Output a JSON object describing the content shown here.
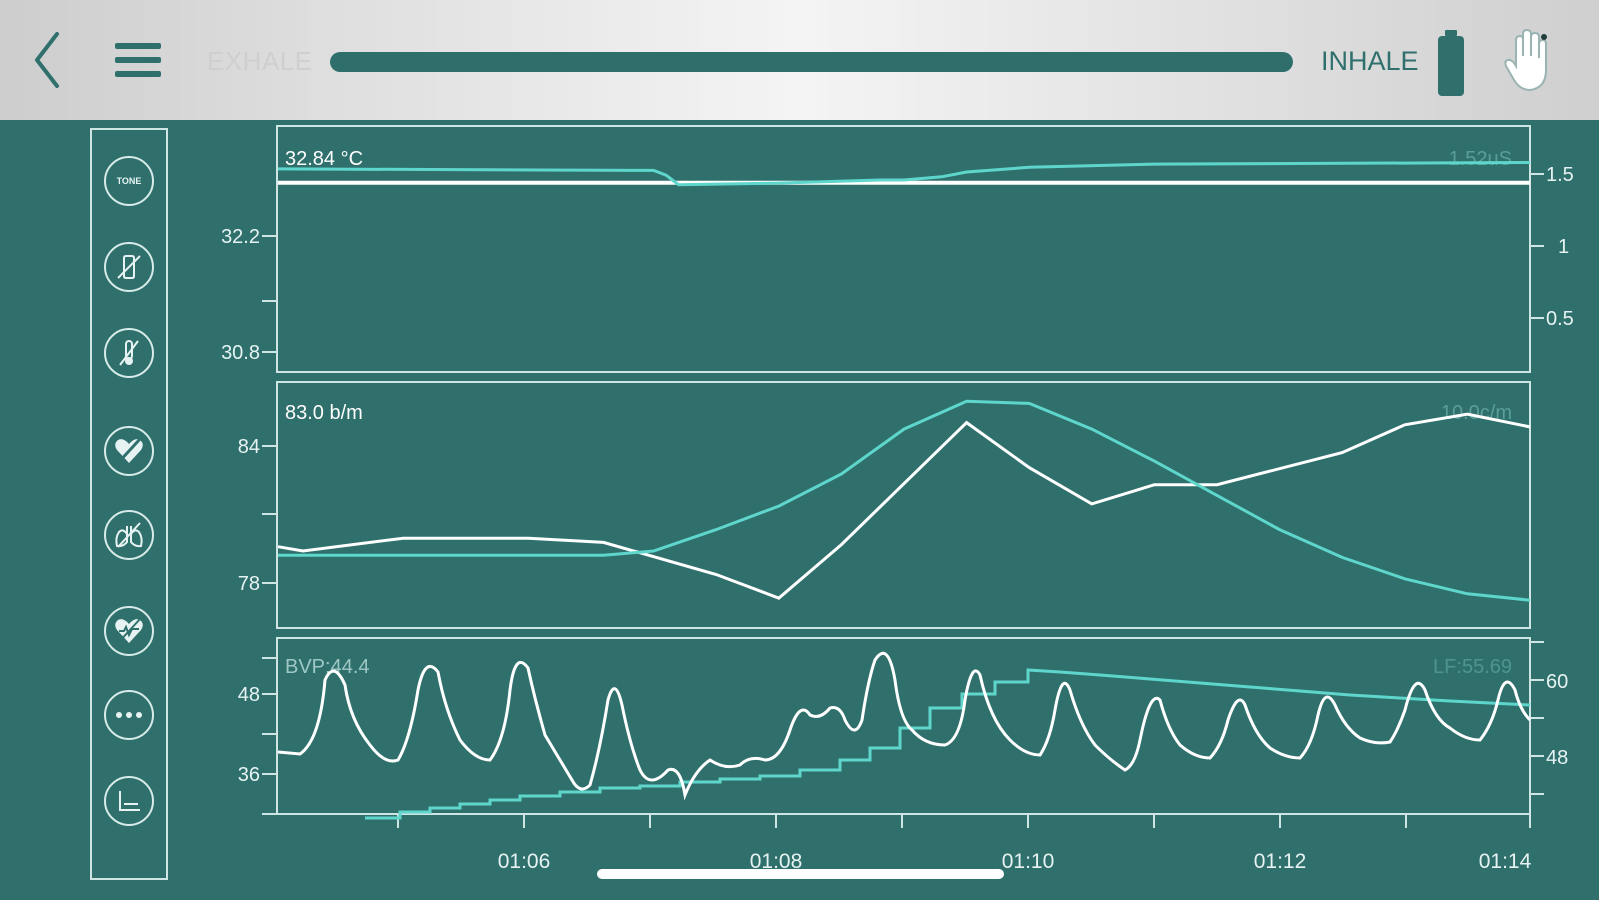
{
  "header": {
    "exhale_label": "EXHALE",
    "inhale_label": "INHALE",
    "breath_progress": 1.0,
    "icons": [
      "chevron-left-icon",
      "hamburger-menu-icon",
      "battery-icon",
      "hand-icon"
    ]
  },
  "sidebar": {
    "items": [
      {
        "name": "tone",
        "label": "TONE"
      },
      {
        "name": "skin-conductance-off"
      },
      {
        "name": "temperature-off"
      },
      {
        "name": "heart-rate-off"
      },
      {
        "name": "breathing-off"
      },
      {
        "name": "heart-variability-off"
      },
      {
        "name": "more"
      },
      {
        "name": "chart-settings"
      }
    ]
  },
  "colors": {
    "background": "#2f706d",
    "trace_white": "#ffffff",
    "trace_cyan": "#5fd6cc",
    "axis": "#cfe5e3"
  },
  "chart_data": [
    {
      "type": "line",
      "panel": "temperature",
      "left_readout": "32.84 °C",
      "right_readout": "1.52uS",
      "left_ticks": [
        "32.2",
        "30.8"
      ],
      "right_ticks": [
        "1.5",
        "1",
        "0.5"
      ],
      "series": [
        {
          "x": [
            0,
            2.5,
            3.1,
            3.3,
            5,
            5.5,
            6,
            7,
            10
          ],
          "values": [
            32.84,
            32.84,
            32.84,
            32.84,
            32.84,
            32.84,
            32.84,
            32.84,
            32.84
          ]
        },
        {
          "x": [
            0,
            3.0,
            3.1,
            3.2,
            4.0,
            4.8,
            5.0,
            5.3,
            5.5,
            6.0,
            7.0,
            10
          ],
          "values": [
            1.48,
            1.47,
            1.44,
            1.38,
            1.39,
            1.41,
            1.41,
            1.43,
            1.46,
            1.49,
            1.51,
            1.52
          ]
        }
      ]
    },
    {
      "type": "line",
      "panel": "heart-rate",
      "left_readout": "83.0 b/m",
      "right_readout": "10.0c/m",
      "left_ticks": [
        "84",
        "78"
      ],
      "series": [
        {
          "x": [
            0,
            0.2,
            1,
            2,
            2.6,
            3.5,
            4,
            4.5,
            5.5,
            6,
            6.5,
            7,
            7.5,
            8.5,
            9,
            9.5,
            10
          ],
          "values": [
            79.8,
            79.6,
            80.2,
            80.2,
            80.0,
            78.5,
            77.4,
            79.9,
            85.6,
            83.5,
            81.8,
            82.7,
            82.7,
            84.2,
            85.5,
            86.0,
            85.4
          ]
        },
        {
          "x": [
            0,
            0.5,
            1,
            2,
            2.6,
            3,
            3.5,
            4,
            4.5,
            5,
            5.5,
            6,
            6.5,
            7,
            7.5,
            8,
            8.5,
            9,
            9.5,
            10
          ],
          "values": [
            79.4,
            79.4,
            79.4,
            79.4,
            79.4,
            79.6,
            80.6,
            81.7,
            83.2,
            85.3,
            86.6,
            86.5,
            85.3,
            83.8,
            82.2,
            80.6,
            79.3,
            78.3,
            77.6,
            77.3
          ]
        }
      ]
    },
    {
      "type": "line",
      "panel": "heart-rate-variability",
      "left_readout": "BVP:44.4",
      "right_readout": "LF:55.69",
      "left_ticks": [
        "48",
        "36"
      ],
      "right_ticks": [
        "60",
        "48"
      ],
      "x_ticks": [
        "01:06",
        "01:08",
        "01:10",
        "01:12",
        "01:14"
      ]
    }
  ],
  "footer": {
    "home_indicator": true
  }
}
